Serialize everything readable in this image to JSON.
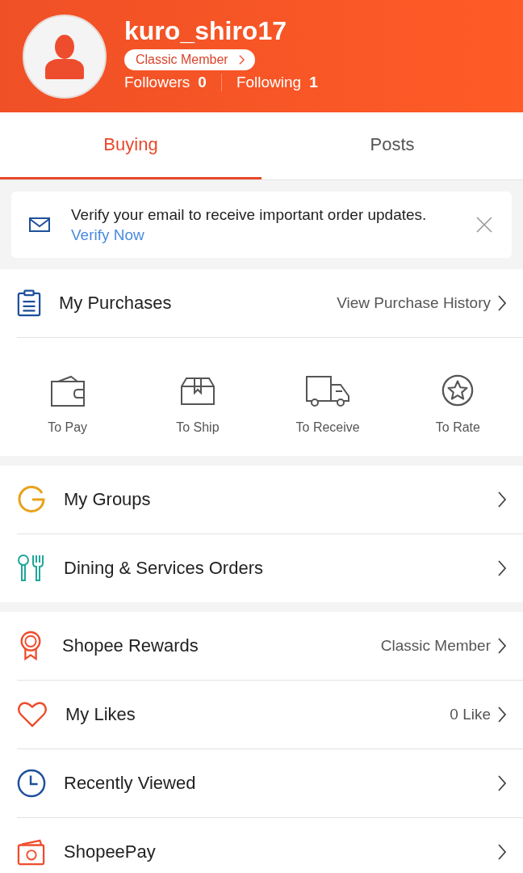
{
  "profile": {
    "username": "kuro_shiro17",
    "membership": "Classic Member",
    "followers_label": "Followers",
    "followers": "0",
    "following_label": "Following",
    "following": "1"
  },
  "tabs": [
    {
      "label": "Buying",
      "selected": true
    },
    {
      "label": "Posts",
      "selected": false
    }
  ],
  "notice": {
    "text": "Verify your email to receive important order updates.",
    "link": "Verify Now"
  },
  "purchases": {
    "title": "My Purchases",
    "detail": "View Purchase History",
    "statuses": [
      {
        "label": "To Pay"
      },
      {
        "label": "To Ship"
      },
      {
        "label": "To Receive"
      },
      {
        "label": "To Rate"
      }
    ]
  },
  "menu_groups": [
    [
      {
        "title": "My Groups"
      },
      {
        "title": "Dining & Services Orders"
      }
    ],
    [
      {
        "title": "Shopee Rewards",
        "detail": "Classic Member"
      },
      {
        "title": "My Likes",
        "detail": "0 Like"
      },
      {
        "title": "Recently Viewed"
      },
      {
        "title": "ShopeePay"
      }
    ]
  ]
}
